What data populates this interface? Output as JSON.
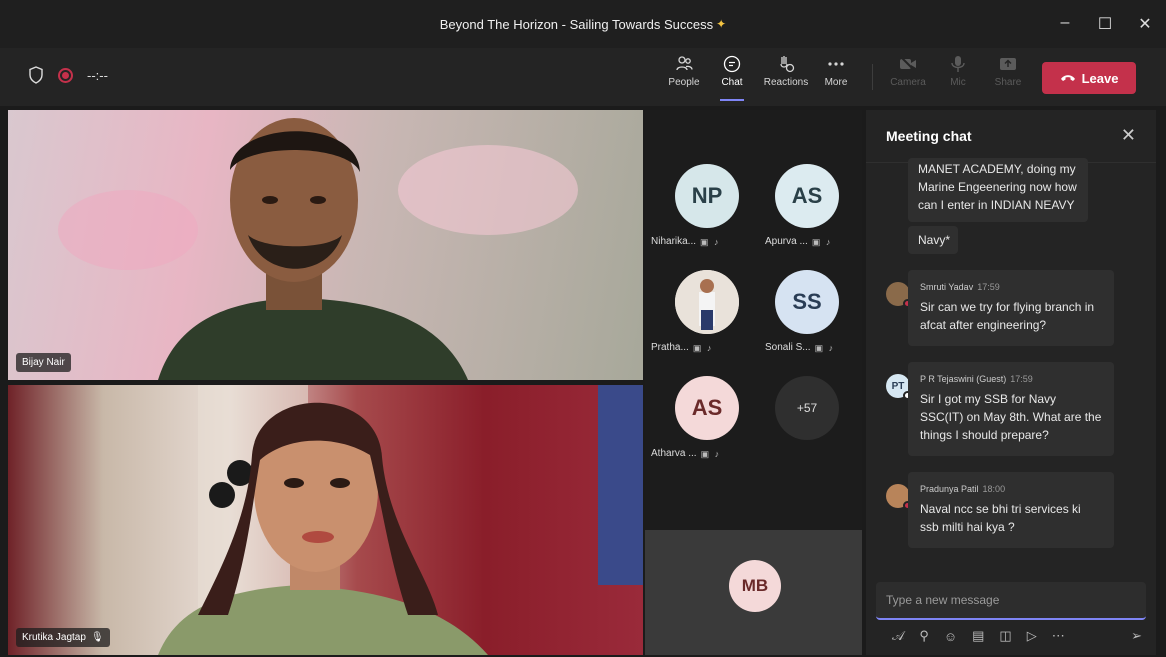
{
  "window": {
    "title": "Beyond The Horizon - Sailing Towards Success",
    "controls": [
      "minimize",
      "maximize",
      "close"
    ]
  },
  "toolbar": {
    "timer": "--:--",
    "buttons": [
      {
        "label": "People",
        "icon": "people-icon"
      },
      {
        "label": "Chat",
        "icon": "chat-icon",
        "active": true
      },
      {
        "label": "Reactions",
        "icon": "reactions-icon"
      },
      {
        "label": "More",
        "icon": "more-icon"
      },
      {
        "label": "Camera",
        "icon": "camera-off-icon",
        "disabled": true
      },
      {
        "label": "Mic",
        "icon": "mic-off-icon",
        "disabled": true
      },
      {
        "label": "Share",
        "icon": "share-icon",
        "disabled": true
      }
    ],
    "leave_label": "Leave",
    "leave_color": "#c4314b"
  },
  "videos": [
    {
      "name": "Bijay Nair"
    },
    {
      "name": "Krutika Jagtap"
    }
  ],
  "participants": [
    {
      "initials": "NP",
      "name": "Niharika..."
    },
    {
      "initials": "AS",
      "name": "Apurva ..."
    },
    {
      "initials": "",
      "name": "Pratha..."
    },
    {
      "initials": "SS",
      "name": "Sonali S..."
    },
    {
      "initials": "AS",
      "name": "Atharva ..."
    },
    {
      "initials": "+57",
      "name": ""
    }
  ],
  "self": {
    "initials": "MB"
  },
  "chat": {
    "title": "Meeting chat",
    "messages": [
      {
        "author": "",
        "time": "",
        "text": "MANET ACADEMY, doing my Marine Engeenering now how can I enter in INDIAN NEAVY"
      },
      {
        "author": "",
        "time": "",
        "text": "Navy*"
      },
      {
        "author": "Smruti Yadav",
        "time": "17:59",
        "text": "Sir can we try for flying branch in afcat after engineering?"
      },
      {
        "author": "P R Tejaswini (Guest)",
        "time": "17:59",
        "initials": "PT",
        "text": "Sir I got my SSB for Navy SSC(IT) on May 8th. What are the things I should prepare?"
      },
      {
        "author": "Pradunya Patil",
        "time": "18:00",
        "text": "Naval ncc se bhi tri services ki ssb milti hai kya ?"
      }
    ],
    "compose_placeholder": "Type a new message",
    "accent": "#7f85f5"
  }
}
